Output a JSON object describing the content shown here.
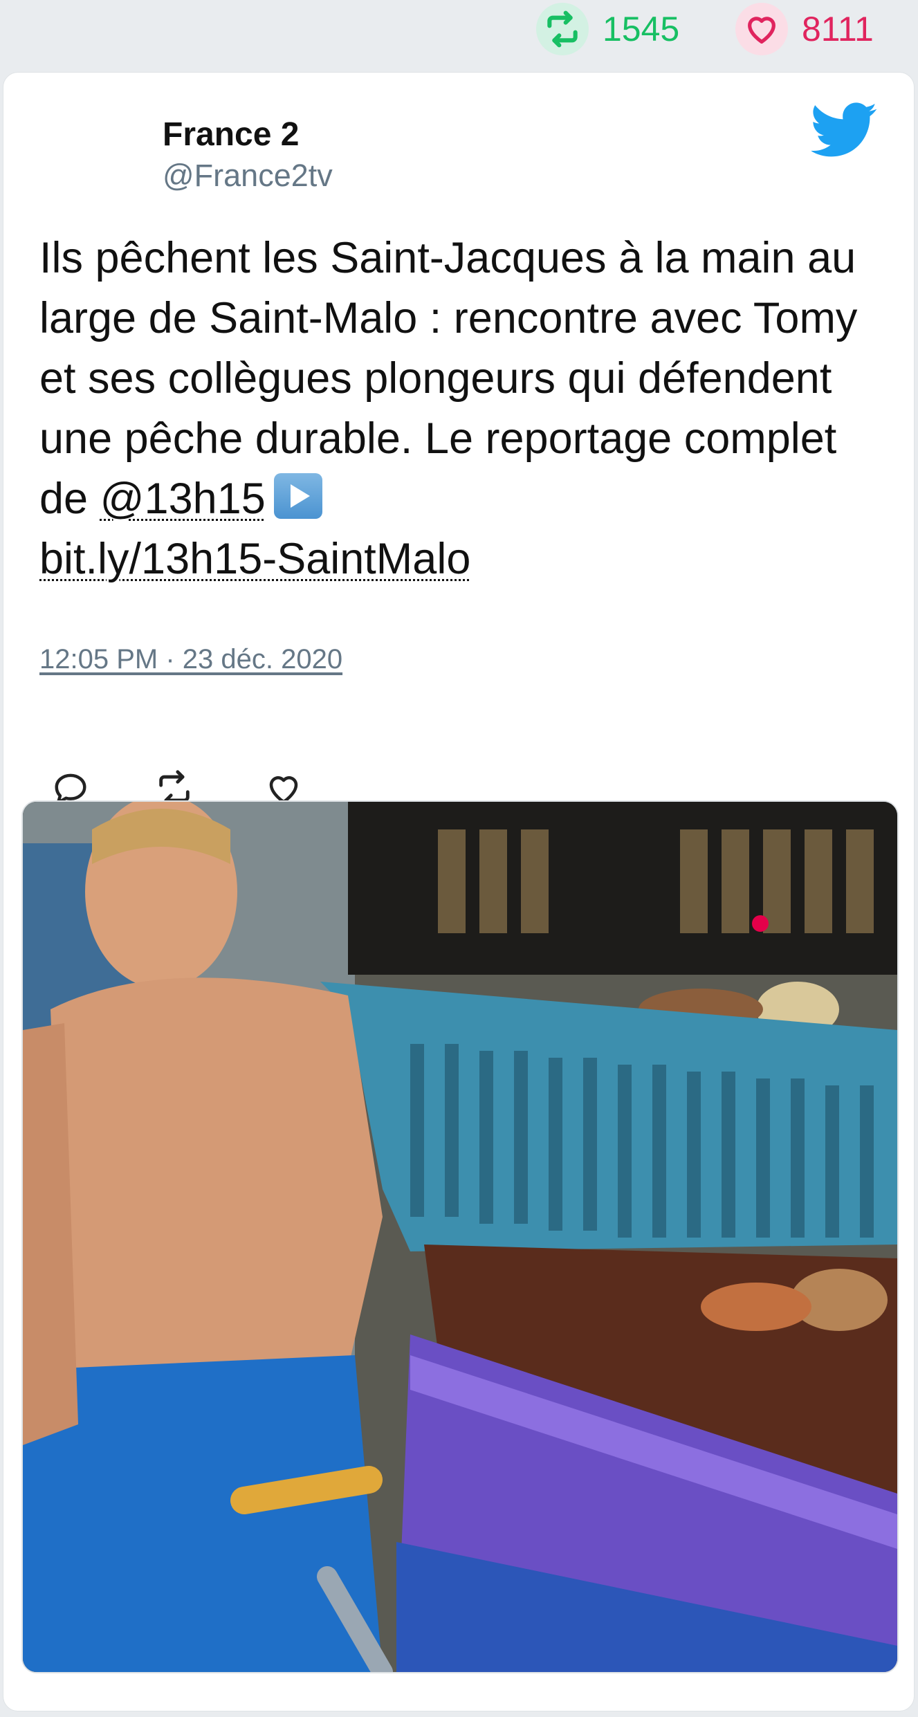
{
  "stats": {
    "retweets": "1545",
    "likes": "8111",
    "retweet_icon": "retweet-icon",
    "like_icon": "heart-icon"
  },
  "tweet": {
    "author_name": "France 2",
    "author_handle": "@France2tv",
    "text_before": "Ils pêchent les Saint-Jacques à la main au large de Saint-Malo : rencontre avec Tomy et ses collègues plongeurs qui défendent une pêche durable. Le reportage complet de ",
    "mention": "@13h15",
    "url": "bit.ly/13h15-SaintMalo",
    "timestamp": "12:05 PM · 23 déc. 2020",
    "bird_icon": "twitter-bird-icon"
  },
  "actions": [
    "reply-icon",
    "retweet-icon",
    "like-icon"
  ],
  "colors": {
    "retweet": "#17bf63",
    "like": "#e0245e",
    "twitter_blue": "#1da1f2",
    "secondary_text": "#657786",
    "background": "#e9ecef"
  },
  "media": {
    "kind": "video-thumbnail"
  }
}
